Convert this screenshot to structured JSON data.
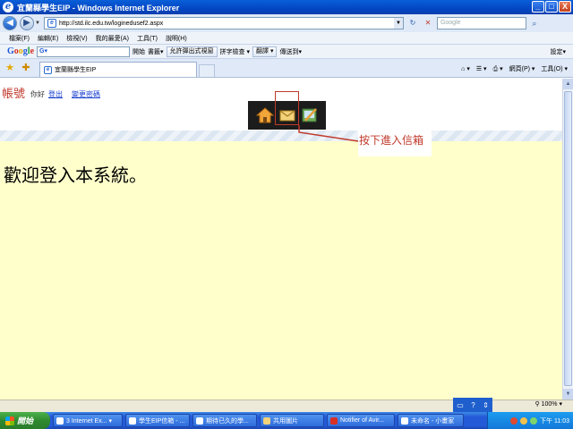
{
  "window": {
    "title": "宜蘭縣學生EIP - Windows Internet Explorer",
    "buttons": [
      "_",
      "□",
      "X"
    ]
  },
  "address_bar": {
    "url": "http://std.ilc.edu.tw/loginedusef2.aspx",
    "search_placeholder": "Google"
  },
  "menu": {
    "items": [
      "檔案(F)",
      "編輯(E)",
      "檢視(V)",
      "我的最愛(A)",
      "工具(T)",
      "說明(H)"
    ]
  },
  "google_toolbar": {
    "logo": [
      "G",
      "o",
      "o",
      "g",
      "l",
      "e"
    ],
    "search_value": "G▾",
    "start": "開始",
    "bookmarks": "書籤▾",
    "popup": "允許彈出式視窗",
    "spell": "拼字檢查 ▾",
    "translate": "翻譯 ▾",
    "send": "傳送到▾",
    "settings": "設定▾"
  },
  "tab": {
    "title": "宜蘭縣學生EIP"
  },
  "command_bar": {
    "page": "網頁(P) ▾",
    "tools": "工具(O) ▾"
  },
  "content": {
    "account_label": "帳號",
    "hello": "你好",
    "logout": "登出",
    "change_password": "變更密碼",
    "annotation": "按下進入信箱",
    "welcome": "歡迎登入本系統。"
  },
  "status_bar": {
    "zoom": "100%"
  },
  "taskbar": {
    "start": "開始",
    "tasks": [
      "3 Internet Ex... ▾",
      "學生EIP信箱 - ...",
      "期待已久的學...",
      "共用圖片",
      "Notifier of Avir...",
      "未命名 - 小畫家"
    ],
    "clock": "下午 11:03"
  },
  "colors": {
    "content_bg": "#ffffcc",
    "annotation": "#c0392b",
    "link": "#1a3fd0"
  }
}
